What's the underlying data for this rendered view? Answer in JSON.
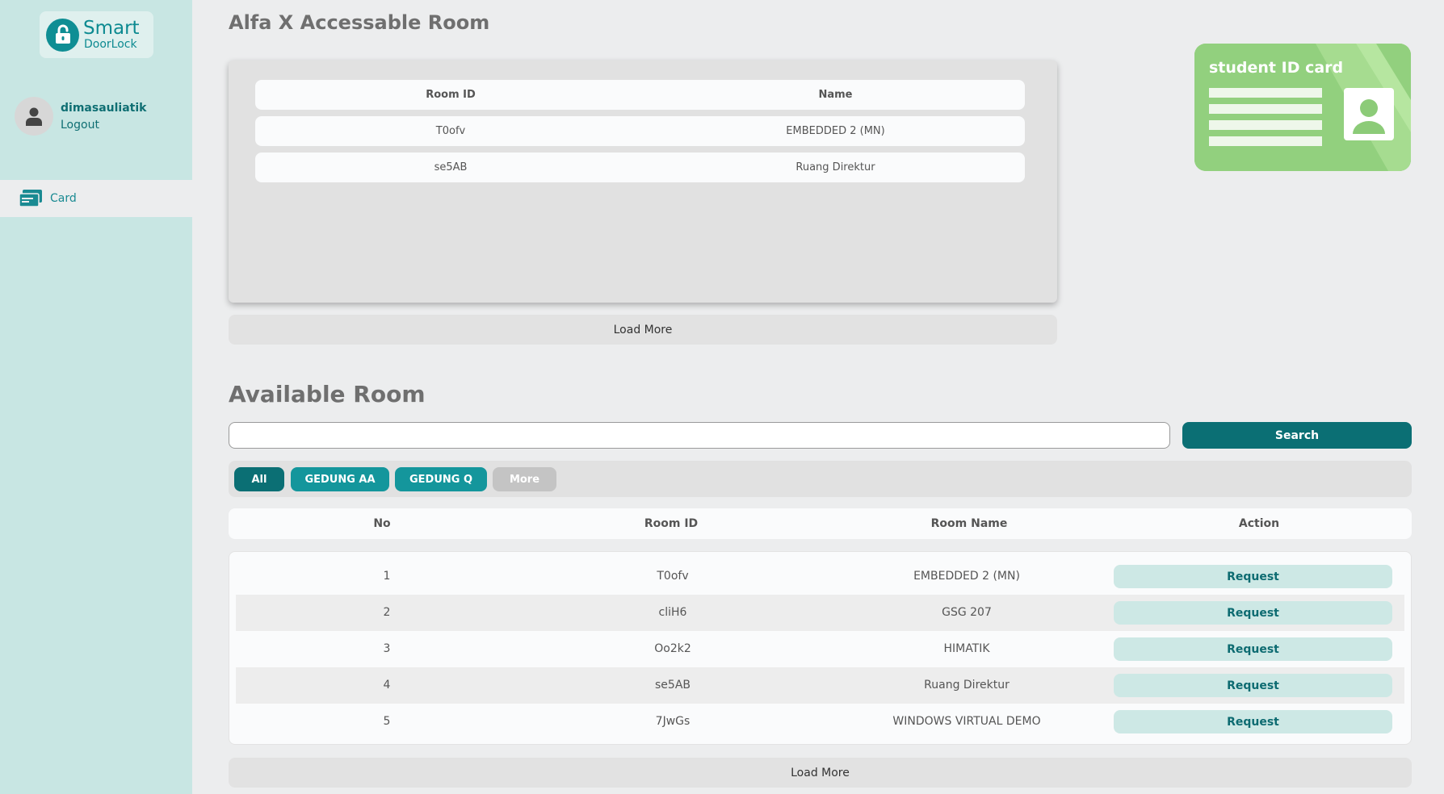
{
  "app": {
    "logo_smart": "Smart",
    "logo_doorlock": "DoorLock"
  },
  "sidebar": {
    "username": "dimasauliatik",
    "logout_label": "Logout",
    "nav_card_label": "Card"
  },
  "accessible": {
    "title": "Alfa X Accessable Room",
    "headers": {
      "room_id": "Room ID",
      "name": "Name"
    },
    "rows": [
      {
        "room_id": "T0ofv",
        "name": "EMBEDDED 2 (MN)"
      },
      {
        "room_id": "se5AB",
        "name": "Ruang Direktur"
      }
    ],
    "load_more_label": "Load More"
  },
  "id_card": {
    "label": "student ID card"
  },
  "available": {
    "title": "Available Room",
    "search_value": "",
    "search_button_label": "Search",
    "filters": {
      "all": "All",
      "gedung_aa": "GEDUNG AA",
      "gedung_q": "GEDUNG Q",
      "more": "More"
    },
    "headers": {
      "no": "No",
      "room_id": "Room ID",
      "room_name": "Room Name",
      "action": "Action"
    },
    "rows": [
      {
        "no": "1",
        "room_id": "T0ofv",
        "room_name": "EMBEDDED 2 (MN)",
        "action": "Request"
      },
      {
        "no": "2",
        "room_id": "cliH6",
        "room_name": "GSG 207",
        "action": "Request"
      },
      {
        "no": "3",
        "room_id": "Oo2k2",
        "room_name": "HIMATIK",
        "action": "Request"
      },
      {
        "no": "4",
        "room_id": "se5AB",
        "room_name": "Ruang Direktur",
        "action": "Request"
      },
      {
        "no": "5",
        "room_id": "7JwGs",
        "room_name": "WINDOWS VIRTUAL DEMO",
        "action": "Request"
      }
    ],
    "load_more_label": "Load More"
  },
  "colors": {
    "sidebar_bg": "#c8e6e3",
    "accent": "#0b6f74",
    "chip_teal": "#14969c",
    "chip_gray": "#c4c4c4",
    "request_bg": "#cde8e5"
  },
  "icons": {
    "logo": "unlocked-padlock-icon",
    "avatar": "user-silhouette-icon",
    "nav_card": "cards-icon"
  }
}
